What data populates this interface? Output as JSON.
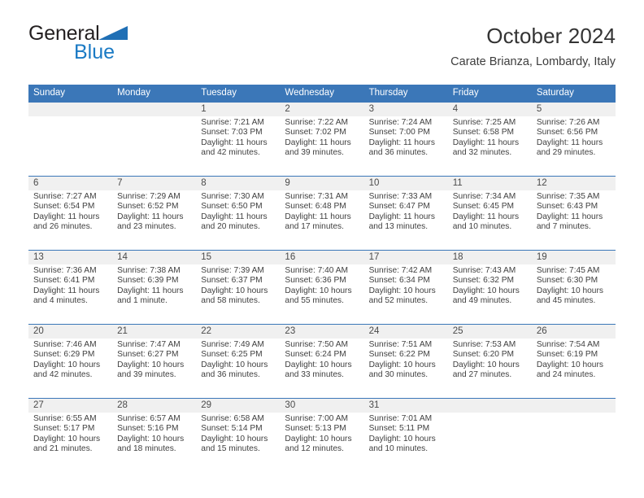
{
  "brand": {
    "name_part1": "General",
    "name_part2": "Blue",
    "flag_icon": "triangle-flag-icon",
    "colors": {
      "part1": "#231f20",
      "part2": "#1a7ac4",
      "flag": "#1f6fb5"
    }
  },
  "header": {
    "title": "October 2024",
    "subtitle": "Carate Brianza, Lombardy, Italy"
  },
  "theme": {
    "header_blue": "#3b77b8",
    "daynum_band": "#f0f0f0",
    "text": "#3f3f3f"
  },
  "weekdays": [
    "Sunday",
    "Monday",
    "Tuesday",
    "Wednesday",
    "Thursday",
    "Friday",
    "Saturday"
  ],
  "weeks": [
    {
      "days": [
        {
          "number": "",
          "sunrise": "",
          "sunset": "",
          "daylight_line1": "",
          "daylight_line2": ""
        },
        {
          "number": "",
          "sunrise": "",
          "sunset": "",
          "daylight_line1": "",
          "daylight_line2": ""
        },
        {
          "number": "1",
          "sunrise": "Sunrise: 7:21 AM",
          "sunset": "Sunset: 7:03 PM",
          "daylight_line1": "Daylight: 11 hours",
          "daylight_line2": "and 42 minutes."
        },
        {
          "number": "2",
          "sunrise": "Sunrise: 7:22 AM",
          "sunset": "Sunset: 7:02 PM",
          "daylight_line1": "Daylight: 11 hours",
          "daylight_line2": "and 39 minutes."
        },
        {
          "number": "3",
          "sunrise": "Sunrise: 7:24 AM",
          "sunset": "Sunset: 7:00 PM",
          "daylight_line1": "Daylight: 11 hours",
          "daylight_line2": "and 36 minutes."
        },
        {
          "number": "4",
          "sunrise": "Sunrise: 7:25 AM",
          "sunset": "Sunset: 6:58 PM",
          "daylight_line1": "Daylight: 11 hours",
          "daylight_line2": "and 32 minutes."
        },
        {
          "number": "5",
          "sunrise": "Sunrise: 7:26 AM",
          "sunset": "Sunset: 6:56 PM",
          "daylight_line1": "Daylight: 11 hours",
          "daylight_line2": "and 29 minutes."
        }
      ]
    },
    {
      "days": [
        {
          "number": "6",
          "sunrise": "Sunrise: 7:27 AM",
          "sunset": "Sunset: 6:54 PM",
          "daylight_line1": "Daylight: 11 hours",
          "daylight_line2": "and 26 minutes."
        },
        {
          "number": "7",
          "sunrise": "Sunrise: 7:29 AM",
          "sunset": "Sunset: 6:52 PM",
          "daylight_line1": "Daylight: 11 hours",
          "daylight_line2": "and 23 minutes."
        },
        {
          "number": "8",
          "sunrise": "Sunrise: 7:30 AM",
          "sunset": "Sunset: 6:50 PM",
          "daylight_line1": "Daylight: 11 hours",
          "daylight_line2": "and 20 minutes."
        },
        {
          "number": "9",
          "sunrise": "Sunrise: 7:31 AM",
          "sunset": "Sunset: 6:48 PM",
          "daylight_line1": "Daylight: 11 hours",
          "daylight_line2": "and 17 minutes."
        },
        {
          "number": "10",
          "sunrise": "Sunrise: 7:33 AM",
          "sunset": "Sunset: 6:47 PM",
          "daylight_line1": "Daylight: 11 hours",
          "daylight_line2": "and 13 minutes."
        },
        {
          "number": "11",
          "sunrise": "Sunrise: 7:34 AM",
          "sunset": "Sunset: 6:45 PM",
          "daylight_line1": "Daylight: 11 hours",
          "daylight_line2": "and 10 minutes."
        },
        {
          "number": "12",
          "sunrise": "Sunrise: 7:35 AM",
          "sunset": "Sunset: 6:43 PM",
          "daylight_line1": "Daylight: 11 hours",
          "daylight_line2": "and 7 minutes."
        }
      ]
    },
    {
      "days": [
        {
          "number": "13",
          "sunrise": "Sunrise: 7:36 AM",
          "sunset": "Sunset: 6:41 PM",
          "daylight_line1": "Daylight: 11 hours",
          "daylight_line2": "and 4 minutes."
        },
        {
          "number": "14",
          "sunrise": "Sunrise: 7:38 AM",
          "sunset": "Sunset: 6:39 PM",
          "daylight_line1": "Daylight: 11 hours",
          "daylight_line2": "and 1 minute."
        },
        {
          "number": "15",
          "sunrise": "Sunrise: 7:39 AM",
          "sunset": "Sunset: 6:37 PM",
          "daylight_line1": "Daylight: 10 hours",
          "daylight_line2": "and 58 minutes."
        },
        {
          "number": "16",
          "sunrise": "Sunrise: 7:40 AM",
          "sunset": "Sunset: 6:36 PM",
          "daylight_line1": "Daylight: 10 hours",
          "daylight_line2": "and 55 minutes."
        },
        {
          "number": "17",
          "sunrise": "Sunrise: 7:42 AM",
          "sunset": "Sunset: 6:34 PM",
          "daylight_line1": "Daylight: 10 hours",
          "daylight_line2": "and 52 minutes."
        },
        {
          "number": "18",
          "sunrise": "Sunrise: 7:43 AM",
          "sunset": "Sunset: 6:32 PM",
          "daylight_line1": "Daylight: 10 hours",
          "daylight_line2": "and 49 minutes."
        },
        {
          "number": "19",
          "sunrise": "Sunrise: 7:45 AM",
          "sunset": "Sunset: 6:30 PM",
          "daylight_line1": "Daylight: 10 hours",
          "daylight_line2": "and 45 minutes."
        }
      ]
    },
    {
      "days": [
        {
          "number": "20",
          "sunrise": "Sunrise: 7:46 AM",
          "sunset": "Sunset: 6:29 PM",
          "daylight_line1": "Daylight: 10 hours",
          "daylight_line2": "and 42 minutes."
        },
        {
          "number": "21",
          "sunrise": "Sunrise: 7:47 AM",
          "sunset": "Sunset: 6:27 PM",
          "daylight_line1": "Daylight: 10 hours",
          "daylight_line2": "and 39 minutes."
        },
        {
          "number": "22",
          "sunrise": "Sunrise: 7:49 AM",
          "sunset": "Sunset: 6:25 PM",
          "daylight_line1": "Daylight: 10 hours",
          "daylight_line2": "and 36 minutes."
        },
        {
          "number": "23",
          "sunrise": "Sunrise: 7:50 AM",
          "sunset": "Sunset: 6:24 PM",
          "daylight_line1": "Daylight: 10 hours",
          "daylight_line2": "and 33 minutes."
        },
        {
          "number": "24",
          "sunrise": "Sunrise: 7:51 AM",
          "sunset": "Sunset: 6:22 PM",
          "daylight_line1": "Daylight: 10 hours",
          "daylight_line2": "and 30 minutes."
        },
        {
          "number": "25",
          "sunrise": "Sunrise: 7:53 AM",
          "sunset": "Sunset: 6:20 PM",
          "daylight_line1": "Daylight: 10 hours",
          "daylight_line2": "and 27 minutes."
        },
        {
          "number": "26",
          "sunrise": "Sunrise: 7:54 AM",
          "sunset": "Sunset: 6:19 PM",
          "daylight_line1": "Daylight: 10 hours",
          "daylight_line2": "and 24 minutes."
        }
      ]
    },
    {
      "days": [
        {
          "number": "27",
          "sunrise": "Sunrise: 6:55 AM",
          "sunset": "Sunset: 5:17 PM",
          "daylight_line1": "Daylight: 10 hours",
          "daylight_line2": "and 21 minutes."
        },
        {
          "number": "28",
          "sunrise": "Sunrise: 6:57 AM",
          "sunset": "Sunset: 5:16 PM",
          "daylight_line1": "Daylight: 10 hours",
          "daylight_line2": "and 18 minutes."
        },
        {
          "number": "29",
          "sunrise": "Sunrise: 6:58 AM",
          "sunset": "Sunset: 5:14 PM",
          "daylight_line1": "Daylight: 10 hours",
          "daylight_line2": "and 15 minutes."
        },
        {
          "number": "30",
          "sunrise": "Sunrise: 7:00 AM",
          "sunset": "Sunset: 5:13 PM",
          "daylight_line1": "Daylight: 10 hours",
          "daylight_line2": "and 12 minutes."
        },
        {
          "number": "31",
          "sunrise": "Sunrise: 7:01 AM",
          "sunset": "Sunset: 5:11 PM",
          "daylight_line1": "Daylight: 10 hours",
          "daylight_line2": "and 10 minutes."
        },
        {
          "number": "",
          "sunrise": "",
          "sunset": "",
          "daylight_line1": "",
          "daylight_line2": ""
        },
        {
          "number": "",
          "sunrise": "",
          "sunset": "",
          "daylight_line1": "",
          "daylight_line2": ""
        }
      ]
    }
  ]
}
